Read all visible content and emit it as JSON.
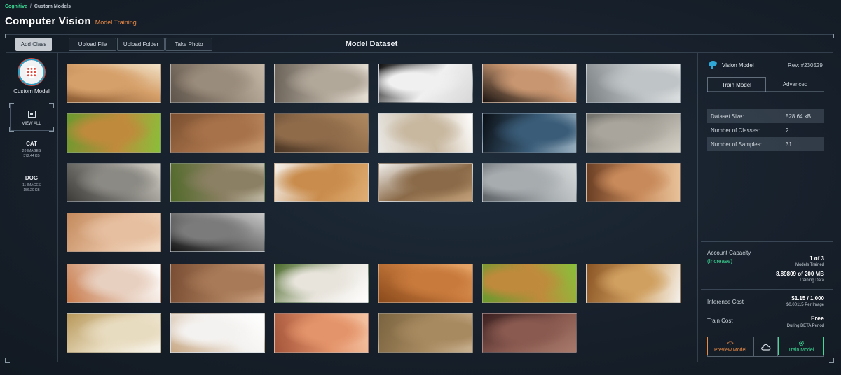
{
  "breadcrumb": {
    "root": "Cognitive",
    "separator": "/",
    "current": "Custom Models"
  },
  "header": {
    "title": "Computer Vision",
    "subtitle": "Model Training"
  },
  "toolbar": {
    "add_class": "Add Class",
    "upload_file": "Upload File",
    "upload_folder": "Upload Folder",
    "take_photo": "Take Photo",
    "dataset_title": "Model Dataset"
  },
  "sidebar": {
    "model_label": "Custom Model",
    "view_all": "VIEW ALL",
    "classes": [
      {
        "name": "CAT",
        "count": "20 IMAGES",
        "size": "372.44 KB"
      },
      {
        "name": "DOG",
        "count": "11 IMAGES",
        "size": "156.20 KB"
      }
    ]
  },
  "images": {
    "cat": [
      {
        "colors": [
          "#8a5a32",
          "#d6a06a",
          "#f1e2c8"
        ]
      },
      {
        "colors": [
          "#5e544a",
          "#9a8c7c",
          "#c6b9a8"
        ]
      },
      {
        "colors": [
          "#6b6259",
          "#b2a89a",
          "#e6dfd4"
        ]
      },
      {
        "colors": [
          "#101010",
          "#f0f0f0",
          "#d8d8d8"
        ]
      },
      {
        "colors": [
          "#1a1412",
          "#c89670",
          "#f2e6dc"
        ]
      },
      {
        "colors": [
          "#7a7f82",
          "#bfc4c6",
          "#e8eaeb"
        ]
      },
      {
        "colors": [
          "#6a9a2e",
          "#c08a3c",
          "#88c03a"
        ]
      },
      {
        "colors": [
          "#7a4f30",
          "#a7724a",
          "#c99a70"
        ]
      },
      {
        "colors": [
          "#4a3524",
          "#8f6b4a",
          "#b08a60"
        ]
      },
      {
        "colors": [
          "#e8e6e2",
          "#c8b8a0",
          "#ffffff"
        ]
      },
      {
        "colors": [
          "#0b0f14",
          "#3a5c78",
          "#9ab0c0"
        ]
      },
      {
        "colors": [
          "#6f6e69",
          "#a9a59c",
          "#d6d1c7"
        ]
      },
      {
        "colors": [
          "#3c3b38",
          "#8c8a84",
          "#d4d1c8"
        ]
      },
      {
        "colors": [
          "#516a2a",
          "#8c8064",
          "#c2bca8"
        ]
      },
      {
        "colors": [
          "#f4f2ef",
          "#c98c4c",
          "#e0ae74"
        ]
      },
      {
        "colors": [
          "#f0eeeb",
          "#8a6a48",
          "#c4a27c"
        ]
      },
      {
        "colors": [
          "#5d6266",
          "#a7acaf",
          "#d7dadb"
        ]
      },
      {
        "colors": [
          "#6a3e24",
          "#c88a5a",
          "#e8c29a"
        ]
      },
      {
        "colors": [
          "#c48a5c",
          "#e6bfa0",
          "#f4dcc6"
        ]
      },
      {
        "colors": [
          "#141414",
          "#7b7b7b",
          "#c8c8c8"
        ]
      }
    ],
    "dog": [
      {
        "colors": [
          "#c87a4a",
          "#e8d0c0",
          "#ffffff"
        ]
      },
      {
        "colors": [
          "#7a4e34",
          "#a87a58",
          "#c8a080"
        ]
      },
      {
        "colors": [
          "#4a6a2a",
          "#e8e4dc",
          "#ffffff"
        ]
      },
      {
        "colors": [
          "#8a4a1c",
          "#c87a3c",
          "#e8a86a"
        ]
      },
      {
        "colors": [
          "#6a9a2e",
          "#c08a3c",
          "#88c03a"
        ]
      },
      {
        "colors": [
          "#8a5424",
          "#d0a060",
          "#f4f0ea"
        ]
      },
      {
        "colors": [
          "#b8985a",
          "#e8dcc0",
          "#f8f4ec"
        ]
      },
      {
        "colors": [
          "#c8a884",
          "#f4f2f0",
          "#ffffff"
        ]
      },
      {
        "colors": [
          "#a4543a",
          "#e4946a",
          "#f4c4a4"
        ]
      },
      {
        "colors": [
          "#7a6440",
          "#a88a60",
          "#c8b090"
        ]
      },
      {
        "colors": [
          "#3a2020",
          "#8a5a50",
          "#a87a6c"
        ]
      }
    ]
  },
  "right_panel": {
    "model_name": "Vision Model",
    "revision": "Rev: #230529",
    "tabs": [
      "Train Model",
      "Advanced"
    ],
    "stats": [
      {
        "label": "Dataset Size:",
        "value": "528.64 kB"
      },
      {
        "label": "Number of Classes:",
        "value": "2"
      },
      {
        "label": "Number of Samples:",
        "value": "31"
      }
    ],
    "capacity": {
      "label": "Account Capacity",
      "increase": "(Increase)",
      "models_value": "1 of 3",
      "models_caption": "Models Trained",
      "data_value": "8.89809 of 200 MB",
      "data_caption": "Training Data"
    },
    "inference": {
      "label": "Inference Cost",
      "value": "$1.15 / 1,000",
      "caption": "$0.00115 Per Image"
    },
    "train_cost": {
      "label": "Train Cost",
      "value": "Free",
      "caption": "During BETA Period"
    },
    "actions": {
      "preview": "Preview Model",
      "preview_icon": "<>",
      "train": "Train Model"
    }
  },
  "theme": {
    "accent_green": "#3ddc97",
    "accent_orange": "#e98a45",
    "background": "#17202b"
  }
}
